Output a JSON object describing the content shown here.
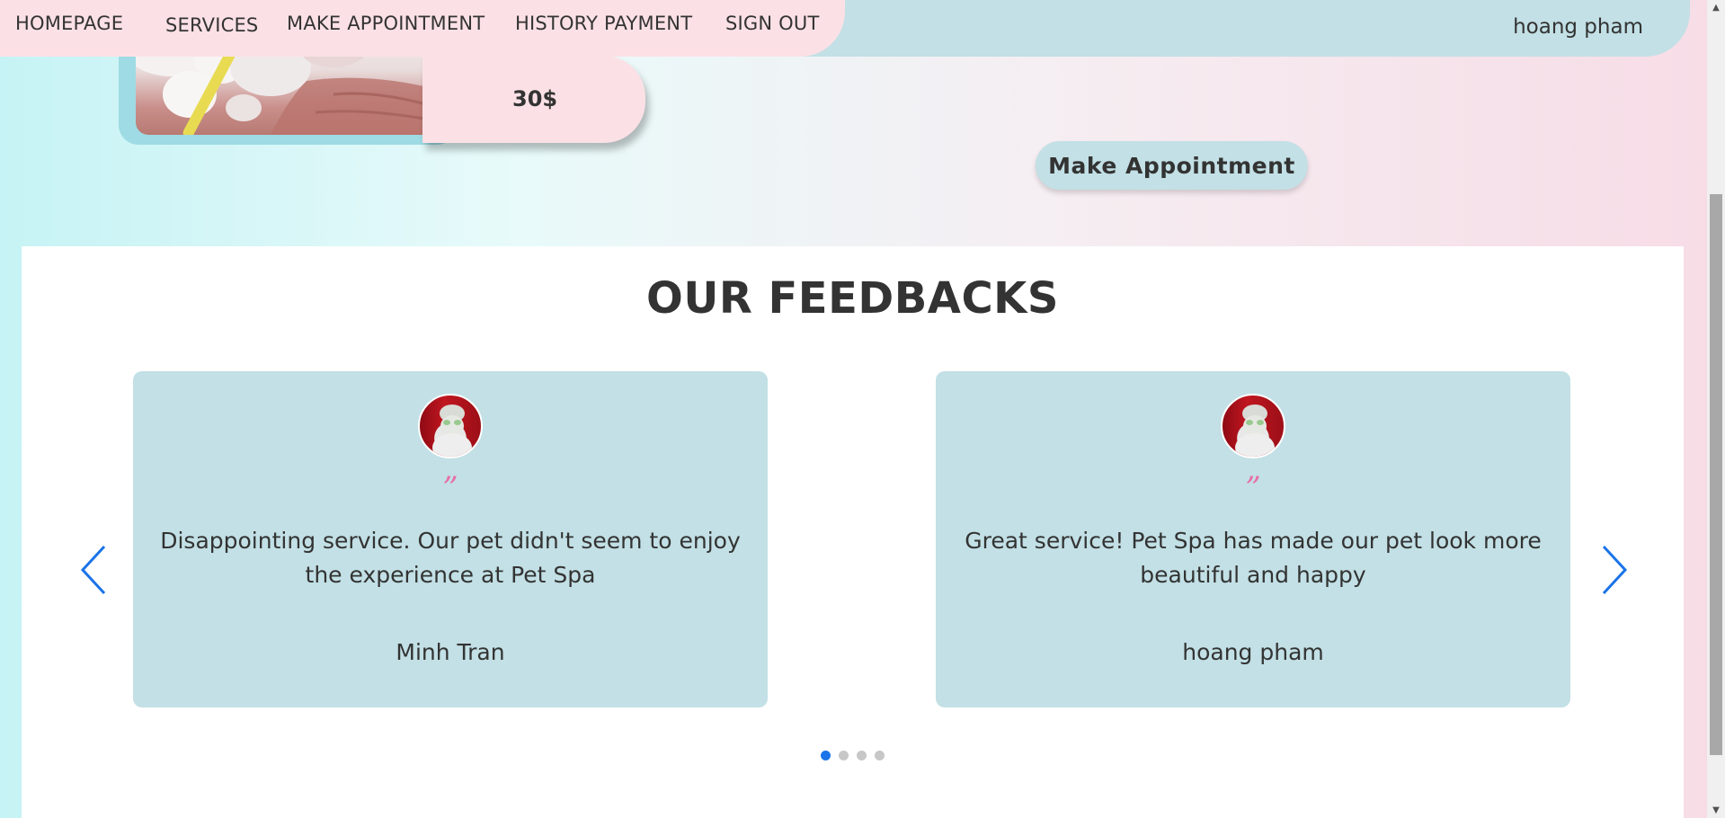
{
  "nav": {
    "items": [
      {
        "label": "HOMEPAGE"
      },
      {
        "label": "SERVICES"
      },
      {
        "label": "MAKE APPOINTMENT"
      },
      {
        "label": "HISTORY PAYMENT"
      },
      {
        "label": "SIGN OUT"
      }
    ],
    "user_name": "hoang pham"
  },
  "service": {
    "price": "30$",
    "appointment_button": "Make Appointment"
  },
  "feedbacks": {
    "title": "OUR FEEDBACKS",
    "quote_mark": "”",
    "cards": [
      {
        "text": "Disappointing service. Our pet didn't seem to enjoy the experience at Pet Spa",
        "author": "Minh Tran"
      },
      {
        "text": "Great service! Pet Spa has made our pet look more beautiful and happy",
        "author": "hoang pham"
      }
    ],
    "carousel": {
      "total_slides": 4,
      "active_slide": 1
    }
  },
  "colors": {
    "nav_pink": "#fbe1e6",
    "nav_blue": "#c2e0e5",
    "card_bg": "#c2e0e5",
    "quote_pink": "#e86ea5",
    "accent_blue": "#1a73e8"
  },
  "icons": {
    "prev": "chevron-left-icon",
    "next": "chevron-right-icon"
  }
}
